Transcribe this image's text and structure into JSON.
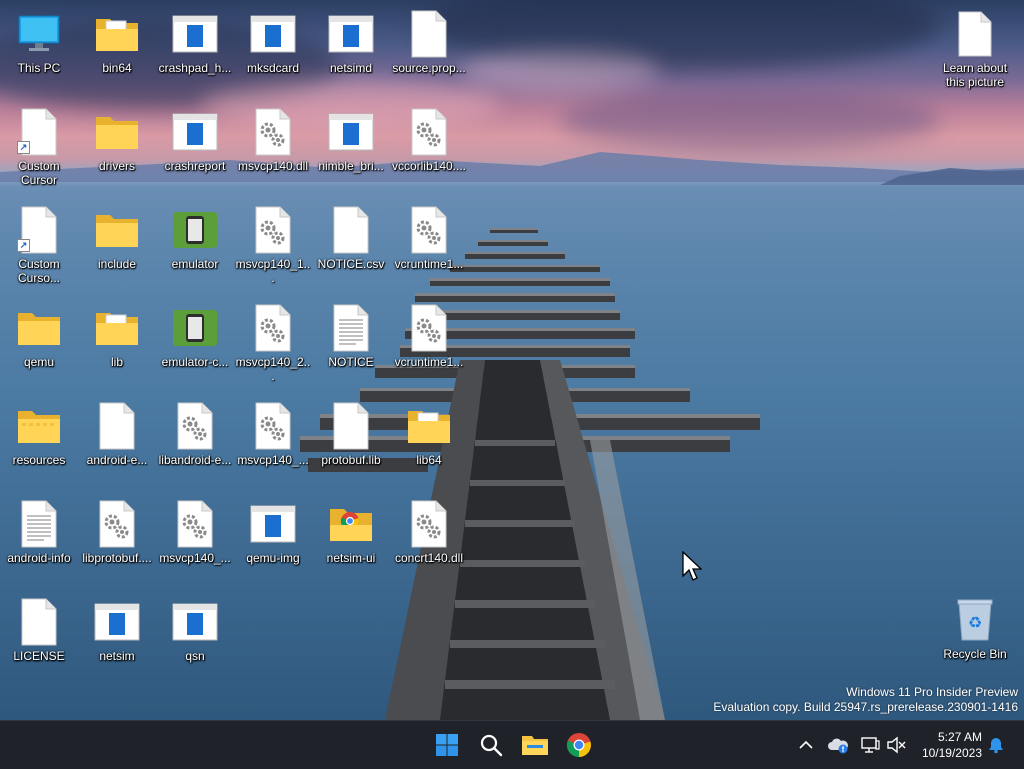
{
  "desktop": {
    "icons": [
      {
        "label": "This PC",
        "type": "pc"
      },
      {
        "label": "bin64",
        "type": "folder-docs"
      },
      {
        "label": "crashpad_h...",
        "type": "app"
      },
      {
        "label": "mksdcard",
        "type": "app"
      },
      {
        "label": "netsimd",
        "type": "app"
      },
      {
        "label": "source.prop...",
        "type": "file"
      },
      {
        "label": "Custom Cursor",
        "type": "file-shortcut"
      },
      {
        "label": "drivers",
        "type": "folder"
      },
      {
        "label": "crashreport",
        "type": "app"
      },
      {
        "label": "msvcp140.dll",
        "type": "dll"
      },
      {
        "label": "nimble_bri...",
        "type": "app"
      },
      {
        "label": "vccorlib140....",
        "type": "dll"
      },
      {
        "label": "Custom Curso...",
        "type": "file-shortcut"
      },
      {
        "label": "include",
        "type": "folder"
      },
      {
        "label": "emulator",
        "type": "emulator"
      },
      {
        "label": "msvcp140_1...",
        "type": "dll"
      },
      {
        "label": "NOTICE.csv",
        "type": "file"
      },
      {
        "label": "vcruntime1...",
        "type": "dll"
      },
      {
        "label": "qemu",
        "type": "folder"
      },
      {
        "label": "lib",
        "type": "folder-docs"
      },
      {
        "label": "emulator-c...",
        "type": "emulator"
      },
      {
        "label": "msvcp140_2...",
        "type": "dll"
      },
      {
        "label": "NOTICE",
        "type": "text"
      },
      {
        "label": "vcruntime1...",
        "type": "dll"
      },
      {
        "label": "resources",
        "type": "folder-grid"
      },
      {
        "label": "android-e...",
        "type": "file"
      },
      {
        "label": "libandroid-e...",
        "type": "dll"
      },
      {
        "label": "msvcp140_...",
        "type": "dll"
      },
      {
        "label": "protobuf.lib",
        "type": "file"
      },
      {
        "label": "lib64",
        "type": "folder-docs"
      },
      {
        "label": "android-info",
        "type": "text"
      },
      {
        "label": "libprotobuf....",
        "type": "dll"
      },
      {
        "label": "msvcp140_...",
        "type": "dll"
      },
      {
        "label": "qemu-img",
        "type": "app"
      },
      {
        "label": "netsim-ui",
        "type": "folder-chrome"
      },
      {
        "label": "concrt140.dll",
        "type": "dll"
      },
      {
        "label": "LICENSE",
        "type": "file"
      },
      {
        "label": "netsim",
        "type": "app"
      },
      {
        "label": "qsn",
        "type": "app"
      }
    ],
    "learn": {
      "label": "Learn about this picture"
    },
    "recycle": {
      "label": "Recycle Bin"
    }
  },
  "watermark": {
    "line1": "Windows 11 Pro Insider Preview",
    "line2": "Evaluation copy. Build 25947.rs_prerelease.230901-1416"
  },
  "taskbar": {
    "time": "5:27 AM",
    "date": "10/19/2023"
  },
  "colors": {
    "taskbar_bg": "#1f2329",
    "folder_yellow": "#f7c948",
    "app_blue": "#1a6fd1",
    "android_green": "#5c9e3a"
  }
}
